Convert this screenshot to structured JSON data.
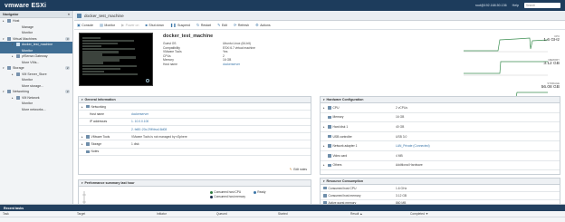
{
  "topbar": {
    "logo_main": "vmware",
    "logo_product": "ESXi",
    "user": "root@192.168.50.136",
    "help": "Help",
    "search_placeholder": "Search"
  },
  "nav": {
    "header": "Navigator",
    "items": [
      {
        "label": "Host"
      },
      {
        "label": "Manage"
      },
      {
        "label": "Monitor"
      },
      {
        "label": "Virtual Machines",
        "count": "3"
      },
      {
        "label": "docker_test_machine"
      },
      {
        "label": "Monitor"
      },
      {
        "label": "pfSense-Gateway"
      },
      {
        "label": "More VMs..."
      },
      {
        "label": "Storage",
        "count": "2"
      },
      {
        "label": "VM Server_Store"
      },
      {
        "label": "Monitor"
      },
      {
        "label": "More storage..."
      },
      {
        "label": "Networking",
        "count": "2"
      },
      {
        "label": "VM Network"
      },
      {
        "label": "Monitor"
      },
      {
        "label": "More networks..."
      }
    ]
  },
  "vm": {
    "title": "docker_test_machine",
    "name": "docker_test_machine",
    "details": [
      {
        "k": "Guest OS",
        "v": "Ubuntu Linux (64-bit)"
      },
      {
        "k": "Compatibility",
        "v": "ESXi 6.7 virtual machine"
      },
      {
        "k": "VMware Tools",
        "v": "Yes"
      },
      {
        "k": "CPUs",
        "v": "2"
      },
      {
        "k": "Memory",
        "v": "16 GB"
      },
      {
        "k": "Host name",
        "v": "dockerserver"
      }
    ]
  },
  "toolbar": [
    {
      "label": "Console",
      "icon": "console-icon",
      "disabled": false
    },
    {
      "label": "Monitor",
      "icon": "monitor-icon",
      "disabled": false
    },
    {
      "label": "Power on",
      "icon": "power-on-icon",
      "disabled": true
    },
    {
      "label": "Shut down",
      "icon": "shut-down-icon",
      "disabled": false
    },
    {
      "label": "Suspend",
      "icon": "suspend-icon",
      "disabled": false
    },
    {
      "label": "Restart",
      "icon": "restart-icon",
      "disabled": false
    },
    {
      "label": "Edit",
      "icon": "edit-icon",
      "disabled": false
    },
    {
      "label": "Refresh",
      "icon": "refresh-icon",
      "disabled": false
    },
    {
      "label": "Actions",
      "icon": "actions-gear-icon",
      "disabled": false
    }
  ],
  "meters": [
    {
      "label": "CPU",
      "value": "1.6 GHz"
    },
    {
      "label": "MEMORY",
      "value": "3.12 GB"
    },
    {
      "label": "STORAGE",
      "value": "56.08 GB"
    }
  ],
  "colors": {
    "accent": "#3b76a8",
    "topbar": "#1d3c5c",
    "selection": "#3f6d93",
    "meter_line": "#3d8f52"
  },
  "general": {
    "title": "General Information",
    "rows": [
      {
        "k": "Networking",
        "v": "",
        "arrow": true,
        "indent": false
      },
      {
        "k": "Host name",
        "v": "dockerserver",
        "arrow": false,
        "indent": true,
        "link": true
      },
      {
        "k": "IP addresses",
        "v": "1. 10.0.0.100",
        "arrow": false,
        "indent": true,
        "link": true
      },
      {
        "k": "",
        "v": "2. fe80::20c:29ff:fea4:8d08",
        "arrow": false,
        "indent": true,
        "link": true
      },
      {
        "k": "VMware Tools",
        "v": "VMware Tools is not managed by vSphere",
        "arrow": true,
        "indent": false
      },
      {
        "k": "Storage",
        "v": "1 disk",
        "arrow": true,
        "indent": false
      },
      {
        "k": "Notes",
        "v": "",
        "arrow": false,
        "indent": false
      }
    ],
    "edit_notes": "Edit notes"
  },
  "hardware": {
    "title": "Hardware Configuration",
    "rows": [
      {
        "k": "CPU",
        "v": "2 vCPUs",
        "arrow": true
      },
      {
        "k": "Memory",
        "v": "16 GB",
        "arrow": false
      },
      {
        "k": "Hard disk 1",
        "v": "40 GB",
        "arrow": true
      },
      {
        "k": "USB controller",
        "v": "USB 3.0",
        "arrow": false
      },
      {
        "k": "Network adapter 1",
        "v": "LAN_Private (Connected)",
        "arrow": true,
        "link": true
      },
      {
        "k": "Video card",
        "v": "4 MB",
        "arrow": false
      },
      {
        "k": "Others",
        "v": "Additional Hardware",
        "arrow": true
      }
    ]
  },
  "perf": {
    "title": "Performance summary last hour",
    "legend": [
      "Consumed host CPU",
      "Ready",
      "Consumed host memory"
    ],
    "legend_colors": [
      "#2f7c3e",
      "#3b76a8",
      "#1c2d4a"
    ]
  },
  "resources": {
    "title": "Resource Consumption",
    "rows": [
      {
        "k": "Consumed host CPU",
        "v": "1.6 GHz"
      },
      {
        "k": "Consumed host memory",
        "v": "3.12 GB"
      },
      {
        "k": "Active guest memory",
        "v": "860 MB"
      },
      {
        "k": "Storage",
        "v": ""
      }
    ]
  },
  "tasks": {
    "title": "Recent tasks",
    "columns": [
      "Task",
      "Target",
      "Initiator",
      "Queued",
      "Started",
      "Result ▲",
      "Completed ▼"
    ]
  }
}
